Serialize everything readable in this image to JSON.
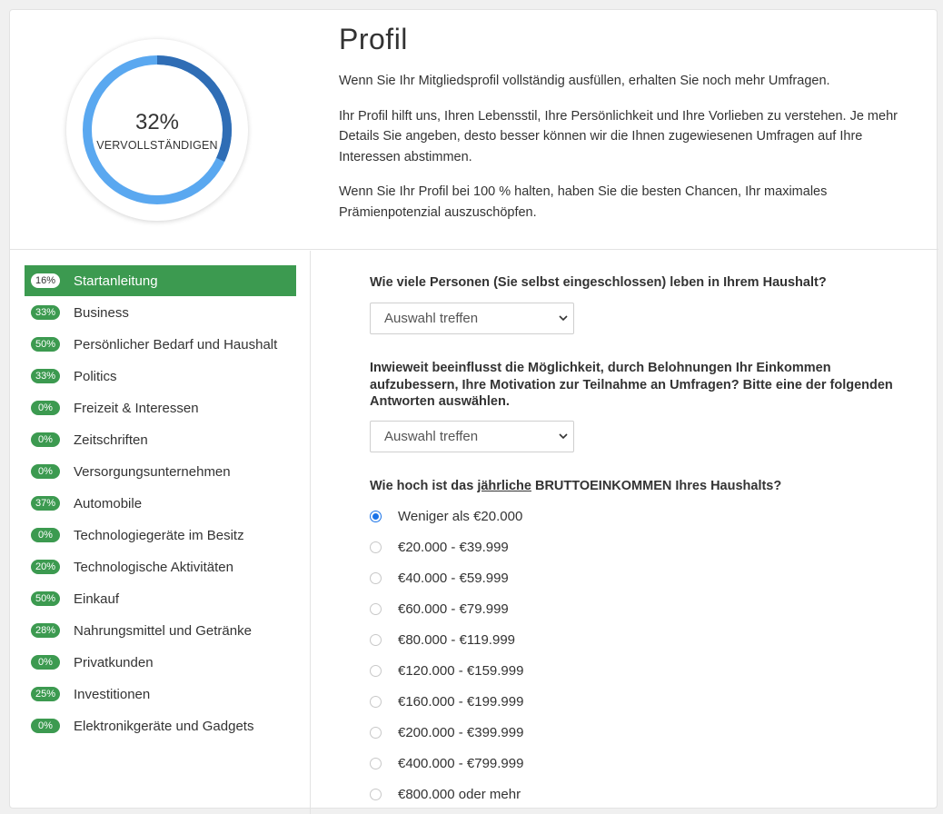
{
  "completion": {
    "percent_text": "32%",
    "label": "VERVOLLSTÄNDIGEN",
    "fraction": 0.32,
    "colors": {
      "filled": "#2f6db5",
      "remaining": "#5aa8f0"
    }
  },
  "intro": {
    "title": "Profil",
    "paragraphs": [
      "Wenn Sie Ihr Mitgliedsprofil vollständig ausfüllen, erhalten Sie noch mehr Umfragen.",
      "Ihr Profil hilft uns, Ihren Lebensstil, Ihre Persönlichkeit und Ihre Vorlieben zu verstehen. Je mehr Details Sie angeben, desto besser können wir die Ihnen zugewiesenen Umfragen auf Ihre Interessen abstimmen.",
      "Wenn Sie Ihr Profil bei 100 % halten, haben Sie die besten Chancen, Ihr maximales Prämienpotenzial auszuschöpfen."
    ]
  },
  "sidebar": {
    "accent": "#3c9a50",
    "items": [
      {
        "badge": "16%",
        "label": "Startanleitung",
        "active": true
      },
      {
        "badge": "33%",
        "label": "Business"
      },
      {
        "badge": "50%",
        "label": "Persönlicher Bedarf und Haushalt"
      },
      {
        "badge": "33%",
        "label": "Politics"
      },
      {
        "badge": "0%",
        "label": "Freizeit & Interessen"
      },
      {
        "badge": "0%",
        "label": "Zeitschriften"
      },
      {
        "badge": "0%",
        "label": "Versorgungsunternehmen"
      },
      {
        "badge": "37%",
        "label": "Automobile"
      },
      {
        "badge": "0%",
        "label": "Technologiegeräte im Besitz"
      },
      {
        "badge": "20%",
        "label": "Technologische Aktivitäten"
      },
      {
        "badge": "50%",
        "label": "Einkauf"
      },
      {
        "badge": "28%",
        "label": "Nahrungsmittel und Getränke"
      },
      {
        "badge": "0%",
        "label": "Privatkunden"
      },
      {
        "badge": "25%",
        "label": "Investitionen"
      },
      {
        "badge": "0%",
        "label": "Elektronikgeräte und Gadgets"
      }
    ]
  },
  "questions": {
    "q1": {
      "text": "Wie viele Personen (Sie selbst eingeschlossen) leben in Ihrem Haushalt?",
      "select_value": "Auswahl treffen"
    },
    "q2": {
      "text": "Inwieweit beeinflusst die Möglichkeit, durch Belohnungen Ihr Einkommen aufzubessern, Ihre Motivation zur Teilnahme an Umfragen? Bitte eine der folgenden Antworten auswählen.",
      "select_value": "Auswahl treffen"
    },
    "q3": {
      "text_before": "Wie hoch ist das ",
      "text_underlined": "jährliche",
      "text_after": " BRUTTOEINKOMMEN Ihres Haushalts?",
      "options": [
        {
          "label": "Weniger als €20.000",
          "selected": true
        },
        {
          "label": "€20.000 - €39.999"
        },
        {
          "label": "€40.000 - €59.999"
        },
        {
          "label": "€60.000 - €79.999"
        },
        {
          "label": "€80.000 - €119.999"
        },
        {
          "label": "€120.000 - €159.999"
        },
        {
          "label": "€160.000 - €199.999"
        },
        {
          "label": "€200.000 - €399.999"
        },
        {
          "label": "€400.000 - €799.999"
        },
        {
          "label": "€800.000 oder mehr"
        }
      ]
    }
  },
  "icons": {
    "dropdown": "chevron-down-icon"
  }
}
